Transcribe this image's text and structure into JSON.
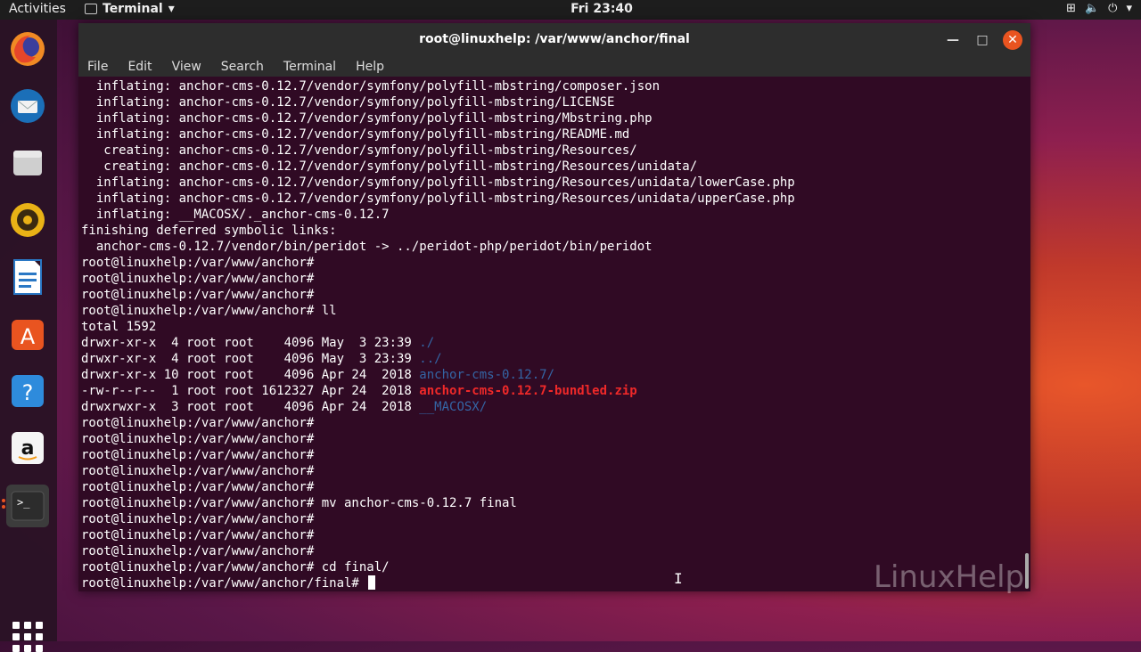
{
  "topbar": {
    "activities": "Activities",
    "app_name": "Terminal",
    "clock": "Fri 23:40"
  },
  "dock": {
    "items": [
      "Firefox",
      "Thunderbird",
      "Files",
      "Rhythmbox",
      "LibreOffice Writer",
      "Ubuntu Software",
      "Help",
      "Amazon",
      "Terminal"
    ]
  },
  "window": {
    "title": "root@linuxhelp: /var/www/anchor/final",
    "menu": [
      "File",
      "Edit",
      "View",
      "Search",
      "Terminal",
      "Help"
    ]
  },
  "terminal": {
    "lines": [
      {
        "text": "  inflating: anchor-cms-0.12.7/vendor/symfony/polyfill-mbstring/composer.json"
      },
      {
        "text": "  inflating: anchor-cms-0.12.7/vendor/symfony/polyfill-mbstring/LICENSE"
      },
      {
        "text": "  inflating: anchor-cms-0.12.7/vendor/symfony/polyfill-mbstring/Mbstring.php"
      },
      {
        "text": "  inflating: anchor-cms-0.12.7/vendor/symfony/polyfill-mbstring/README.md"
      },
      {
        "text": "   creating: anchor-cms-0.12.7/vendor/symfony/polyfill-mbstring/Resources/"
      },
      {
        "text": "   creating: anchor-cms-0.12.7/vendor/symfony/polyfill-mbstring/Resources/unidata/"
      },
      {
        "text": "  inflating: anchor-cms-0.12.7/vendor/symfony/polyfill-mbstring/Resources/unidata/lowerCase.php"
      },
      {
        "text": "  inflating: anchor-cms-0.12.7/vendor/symfony/polyfill-mbstring/Resources/unidata/upperCase.php"
      },
      {
        "text": "  inflating: __MACOSX/._anchor-cms-0.12.7"
      },
      {
        "text": "finishing deferred symbolic links:"
      },
      {
        "text": "  anchor-cms-0.12.7/vendor/bin/peridot -> ../peridot-php/peridot/bin/peridot"
      },
      {
        "text": "root@linuxhelp:/var/www/anchor# "
      },
      {
        "text": "root@linuxhelp:/var/www/anchor# "
      },
      {
        "text": "root@linuxhelp:/var/www/anchor# "
      },
      {
        "text": "root@linuxhelp:/var/www/anchor# ll"
      },
      {
        "text": "total 1592"
      },
      {
        "text": "drwxr-xr-x  4 root root    4096 May  3 23:39 ",
        "colored": "./",
        "color": "blue"
      },
      {
        "text": "drwxr-xr-x  4 root root    4096 May  3 23:39 ",
        "colored": "../",
        "color": "blue"
      },
      {
        "text": "drwxr-xr-x 10 root root    4096 Apr 24  2018 ",
        "colored": "anchor-cms-0.12.7/",
        "color": "blue"
      },
      {
        "text": "-rw-r--r--  1 root root 1612327 Apr 24  2018 ",
        "colored": "anchor-cms-0.12.7-bundled.zip",
        "color": "red"
      },
      {
        "text": "drwxrwxr-x  3 root root    4096 Apr 24  2018 ",
        "colored": "__MACOSX/",
        "color": "blue"
      },
      {
        "text": "root@linuxhelp:/var/www/anchor# "
      },
      {
        "text": "root@linuxhelp:/var/www/anchor# "
      },
      {
        "text": "root@linuxhelp:/var/www/anchor# "
      },
      {
        "text": "root@linuxhelp:/var/www/anchor# "
      },
      {
        "text": "root@linuxhelp:/var/www/anchor# "
      },
      {
        "text": "root@linuxhelp:/var/www/anchor# mv anchor-cms-0.12.7 final"
      },
      {
        "text": "root@linuxhelp:/var/www/anchor# "
      },
      {
        "text": "root@linuxhelp:/var/www/anchor# "
      },
      {
        "text": "root@linuxhelp:/var/www/anchor# "
      },
      {
        "text": "root@linuxhelp:/var/www/anchor# cd final/"
      },
      {
        "text": "root@linuxhelp:/var/www/anchor/final# ",
        "cursor": true
      }
    ]
  },
  "watermark": "LinuxHelp",
  "colors": {
    "terminal_bg": "#300a24",
    "titlebar_bg": "#2d2d2d",
    "accent": "#e95420",
    "dir_blue": "#3465a4",
    "archive_red": "#ef2929"
  }
}
